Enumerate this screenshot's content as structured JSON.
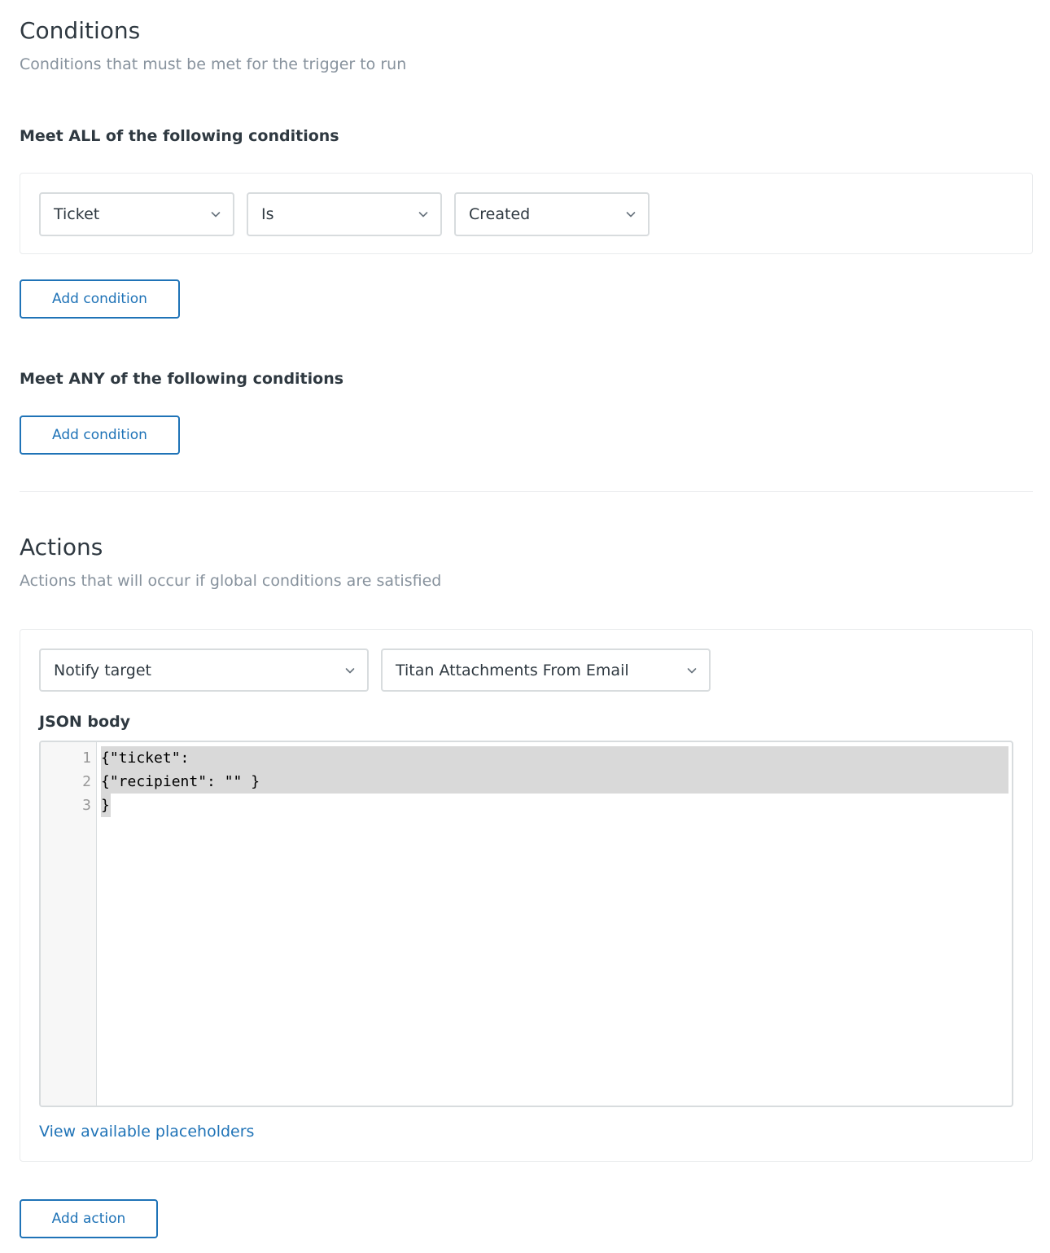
{
  "conditions": {
    "title": "Conditions",
    "subtitle": "Conditions that must be met for the trigger to run",
    "all_label": "Meet ALL of the following conditions",
    "all_row": {
      "field": "Ticket",
      "operator": "Is",
      "value": "Created"
    },
    "add_all_label": "Add condition",
    "any_label": "Meet ANY of the following conditions",
    "add_any_label": "Add condition"
  },
  "actions": {
    "title": "Actions",
    "subtitle": "Actions that will occur if global conditions are satisfied",
    "row": {
      "action": "Notify target",
      "target": "Titan Attachments From Email"
    },
    "json_label": "JSON body",
    "json_lines": [
      {
        "num": "1",
        "text": "{\"ticket\":"
      },
      {
        "num": "2",
        "text": "{\"recipient\": \"\" }"
      },
      {
        "num": "3",
        "text": "}"
      }
    ],
    "placeholders_link": "View available placeholders",
    "add_action_label": "Add action"
  },
  "icons": {
    "dropdown": "chevron-down-icon"
  },
  "colors": {
    "accent": "#1f73b7",
    "text": "#2f3941",
    "muted": "#87929d",
    "border": "#d8dcde"
  }
}
